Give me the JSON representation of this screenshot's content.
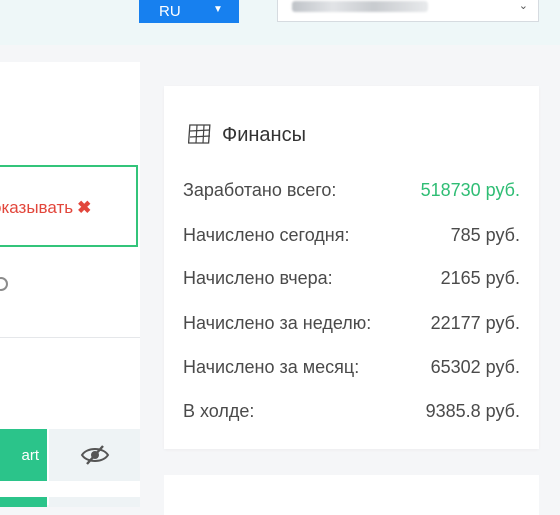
{
  "header": {
    "lang_label": "RU",
    "account_select_value": ""
  },
  "left": {
    "hide_label": "оказывать",
    "start_label": "art"
  },
  "finance": {
    "title": "Финансы",
    "rows": [
      {
        "label": "Заработано всего:",
        "value": "518730 руб.",
        "highlight": true
      },
      {
        "label": "Начислено сегодня:",
        "value": "785 руб."
      },
      {
        "label": "Начислено вчера:",
        "value": "2165 руб."
      },
      {
        "label": "Начислено за неделю:",
        "value": "22177 руб."
      },
      {
        "label": "Начислено за месяц:",
        "value": "65302 руб."
      },
      {
        "label": "В холде:",
        "value": "9385.8 руб."
      }
    ]
  },
  "colors": {
    "accent_blue": "#1780ef",
    "green": "#2bc48a",
    "highlight_green": "#2fbd74",
    "red": "#e2463b"
  }
}
